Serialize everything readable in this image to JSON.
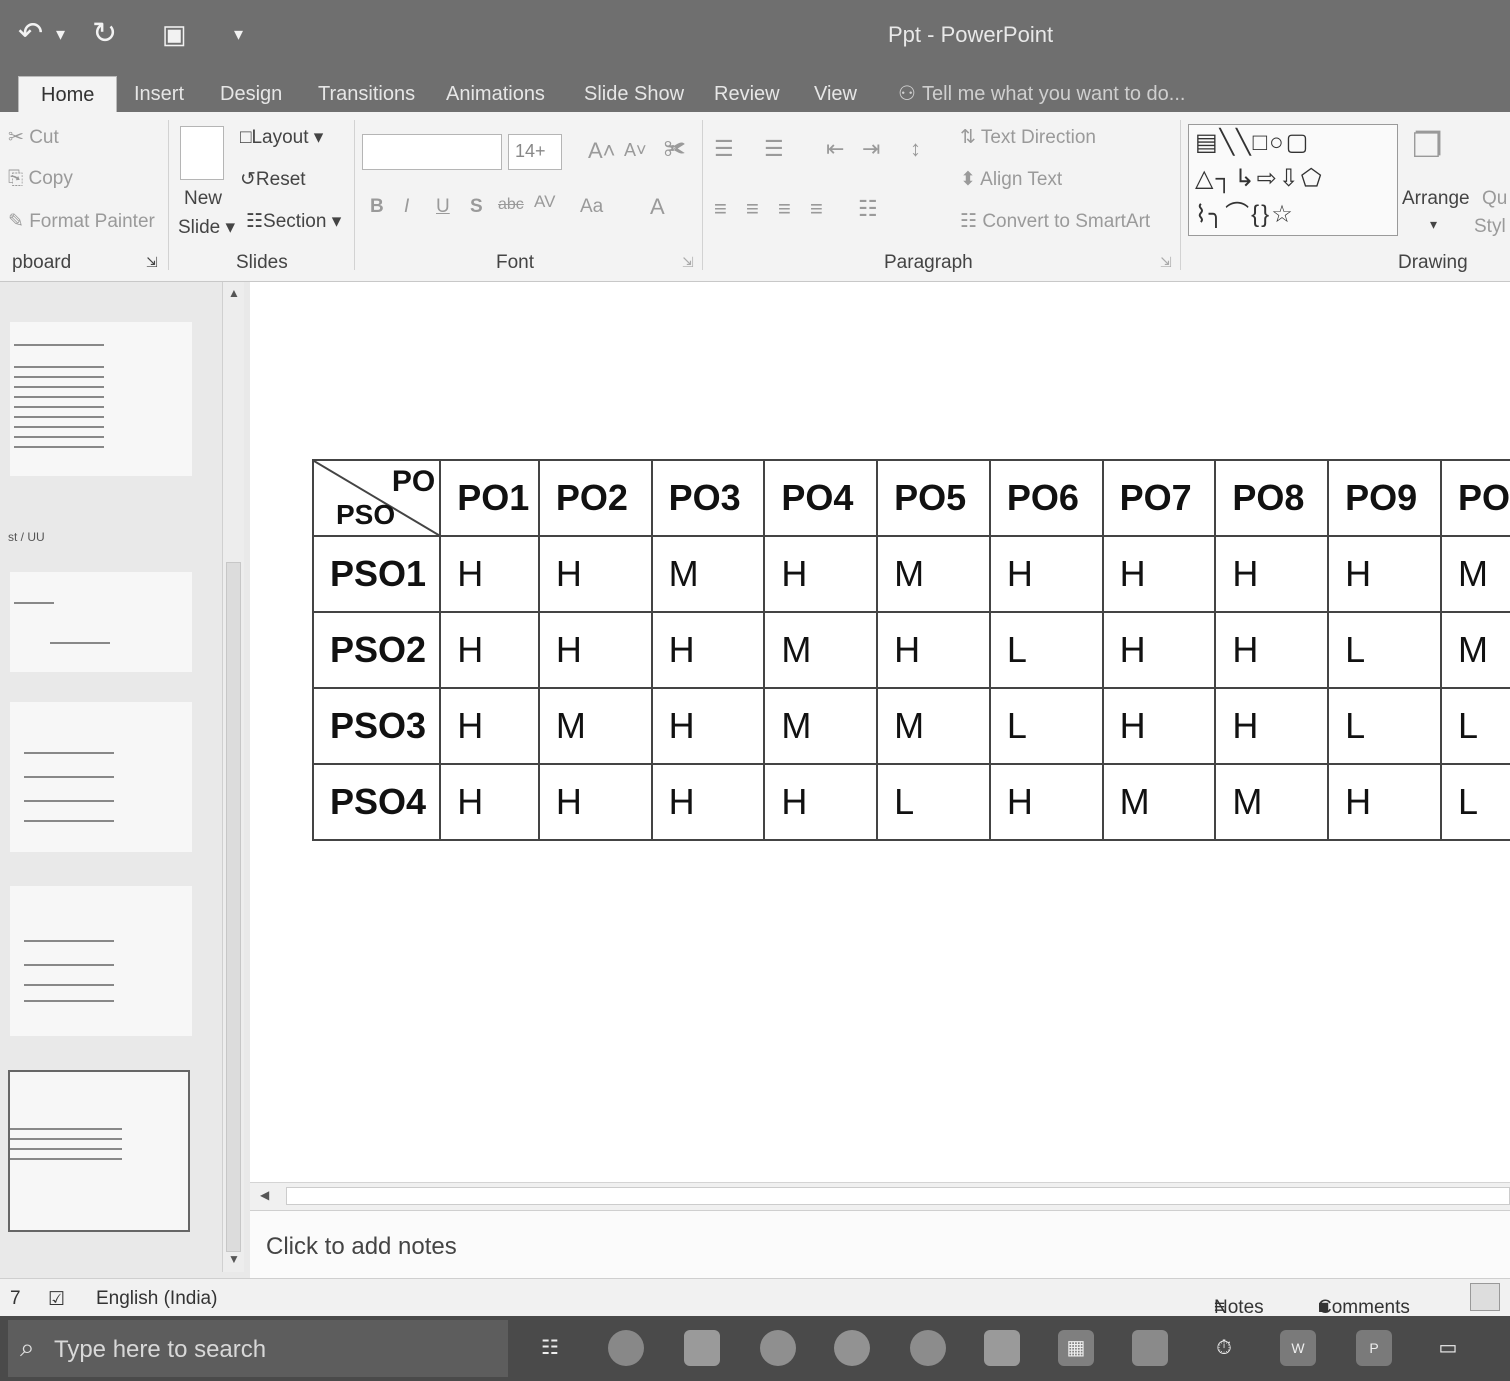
{
  "window": {
    "title": "Ppt - PowerPoint"
  },
  "tabs": [
    "Home",
    "Insert",
    "Design",
    "Transitions",
    "Animations",
    "Slide Show",
    "Review",
    "View"
  ],
  "tell_me": "Tell me what you want to do...",
  "ribbon": {
    "clipboard": {
      "cut": "Cut",
      "copy": "Copy",
      "format_painter": "Format Painter",
      "label": "pboard"
    },
    "slides": {
      "new_slide": "New",
      "new_slide_2": "Slide",
      "layout": "Layout",
      "reset": "Reset",
      "section": "Section",
      "label": "Slides"
    },
    "font": {
      "size": "14+",
      "label": "Font",
      "bold": "B",
      "italic": "I",
      "underline": "U",
      "shadow": "S",
      "strike": "abc",
      "spacing": "AV",
      "case": "Aa",
      "color": "A"
    },
    "paragraph": {
      "text_direction": "Text Direction",
      "align_text": "Align Text",
      "convert_smartart": "Convert to SmartArt",
      "label": "Paragraph"
    },
    "drawing": {
      "arrange": "Arrange",
      "quick_styles_1": "Qu",
      "quick_styles_2": "Styl",
      "label": "Drawing"
    }
  },
  "table": {
    "corner_top": "PO",
    "corner_bottom": "PSO",
    "columns": [
      "PO1",
      "PO2",
      "PO3",
      "PO4",
      "PO5",
      "PO6",
      "PO7",
      "PO8",
      "PO9",
      "PO"
    ],
    "rows": [
      {
        "label": "PSO1",
        "cells": [
          "H",
          "H",
          "M",
          "H",
          "M",
          "H",
          "H",
          "H",
          "H",
          "M"
        ]
      },
      {
        "label": "PSO2",
        "cells": [
          "H",
          "H",
          "H",
          "M",
          "H",
          "L",
          "H",
          "H",
          "L",
          "M"
        ]
      },
      {
        "label": "PSO3",
        "cells": [
          "H",
          "M",
          "H",
          "M",
          "M",
          "L",
          "H",
          "H",
          "L",
          "L"
        ]
      },
      {
        "label": "PSO4",
        "cells": [
          "H",
          "H",
          "H",
          "H",
          "L",
          "H",
          "M",
          "M",
          "H",
          "L"
        ]
      }
    ]
  },
  "notes_placeholder": "Click to add notes",
  "status": {
    "slide_num": "7",
    "language": "English (India)",
    "notes": "Notes",
    "comments": "Comments"
  },
  "taskbar": {
    "search_placeholder": "Type here to search"
  },
  "thumb_caption": "st / UU"
}
